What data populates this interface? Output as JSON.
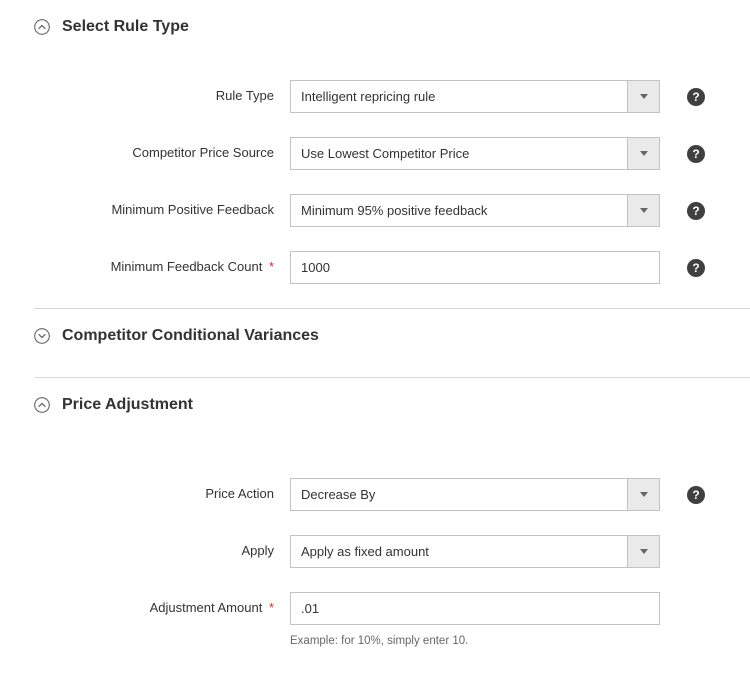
{
  "sections": {
    "select_rule_type": {
      "title": "Select Rule Type",
      "fields": {
        "rule_type": {
          "label": "Rule Type",
          "value": "Intelligent repricing rule"
        },
        "competitor_price_source": {
          "label": "Competitor Price Source",
          "value": "Use Lowest Competitor Price"
        },
        "min_positive_feedback": {
          "label": "Minimum Positive Feedback",
          "value": "Minimum 95% positive feedback"
        },
        "min_feedback_count": {
          "label": "Minimum Feedback Count",
          "value": "1000"
        }
      }
    },
    "competitor_variances": {
      "title": "Competitor Conditional Variances"
    },
    "price_adjustment": {
      "title": "Price Adjustment",
      "fields": {
        "price_action": {
          "label": "Price Action",
          "value": "Decrease By"
        },
        "apply": {
          "label": "Apply",
          "value": "Apply as fixed amount"
        },
        "adjustment_amount": {
          "label": "Adjustment Amount",
          "value": ".01",
          "note": "Example: for 10%, simply enter 10."
        }
      }
    }
  },
  "glyphs": {
    "required": "*",
    "help": "?"
  }
}
